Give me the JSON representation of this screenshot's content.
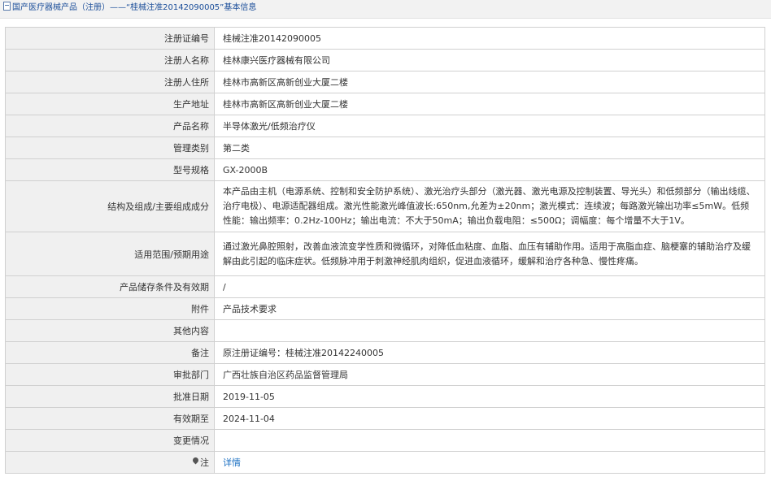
{
  "breadcrumb": {
    "root": "国产医疗器械产品（注册）",
    "separator": "——",
    "current": "“桂械注准20142090005”基本信息"
  },
  "rows": [
    {
      "label": "注册证编号",
      "value": "桂械注准20142090005"
    },
    {
      "label": "注册人名称",
      "value": "桂林康兴医疗器械有限公司"
    },
    {
      "label": "注册人住所",
      "value": "桂林市高新区高新创业大厦二楼"
    },
    {
      "label": "生产地址",
      "value": "桂林市高新区高新创业大厦二楼"
    },
    {
      "label": "产品名称",
      "value": "半导体激光/低频治疗仪"
    },
    {
      "label": "管理类别",
      "value": "第二类"
    },
    {
      "label": "型号规格",
      "value": "GX-2000B"
    },
    {
      "label": "结构及组成/主要组成成分",
      "value": "本产品由主机（电源系统、控制和安全防护系统）、激光治疗头部分（激光器、激光电源及控制装置、导光头）和低频部分（输出线缆、治疗电极）、电源适配器组成。激光性能激光峰值波长:650nm,允差为±20nm；激光模式：连续波；每路激光输出功率≤5mW。低频性能：输出频率：0.2Hz-100Hz；输出电流：不大于50mA；输出负载电阻：≤500Ω；调幅度：每个增量不大于1V。"
    },
    {
      "label": "适用范围/预期用途",
      "value": "通过激光鼻腔照射，改善血液流变学性质和微循环，对降低血粘度、血脂、血压有辅助作用。适用于高脂血症、脑梗塞的辅助治疗及缓解由此引起的临床症状。低频脉冲用于刺激神经肌肉组织，促进血液循环，缓解和治疗各种急、慢性疼痛。"
    },
    {
      "label": "产品储存条件及有效期",
      "value": "/"
    },
    {
      "label": "附件",
      "value": "产品技术要求"
    },
    {
      "label": "其他内容",
      "value": ""
    },
    {
      "label": "备注",
      "value": "原注册证编号：桂械注准20142240005"
    },
    {
      "label": "审批部门",
      "value": "广西壮族自治区药品监督管理局"
    },
    {
      "label": "批准日期",
      "value": "2019-11-05"
    },
    {
      "label": "有效期至",
      "value": "2024-11-04"
    },
    {
      "label": "变更情况",
      "value": ""
    },
    {
      "label": "注",
      "value": "详情",
      "icon": "pin-icon"
    }
  ]
}
